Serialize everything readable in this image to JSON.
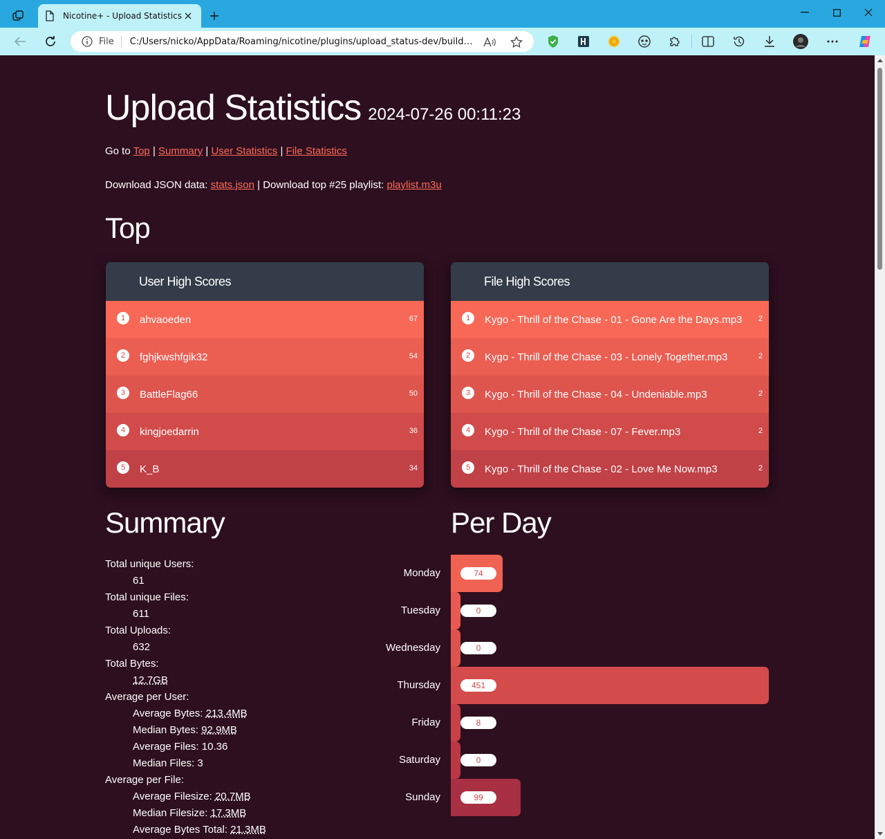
{
  "browser": {
    "tab_title": "Nicotine+ - Upload Statistics",
    "scheme": "File",
    "url": "C:/Users/nicko/AppData/Roaming/nicotine/plugins/upload_status-dev/build/in..."
  },
  "page": {
    "title": "Upload Statistics",
    "timestamp": "2024-07-26 00:11:23",
    "nav": {
      "prefix": "Go to",
      "links": [
        "Top",
        "Summary",
        "User Statistics",
        "File Statistics"
      ]
    },
    "downloads": {
      "json_prefix": "Download JSON data:",
      "json_link": "stats.json",
      "playlist_prefix": "| Download top #25 playlist:",
      "playlist_link": "playlist.m3u"
    },
    "top_heading": "Top",
    "user_scores": {
      "title": "User High Scores",
      "rows": [
        {
          "rank": "1",
          "name": "ahvaoeden",
          "score": "67"
        },
        {
          "rank": "2",
          "name": "fghjkwshfgik32",
          "score": "54"
        },
        {
          "rank": "3",
          "name": "BattleFlag66",
          "score": "50"
        },
        {
          "rank": "4",
          "name": "kingjoedarrin",
          "score": "36"
        },
        {
          "rank": "5",
          "name": "K_B",
          "score": "34"
        }
      ]
    },
    "file_scores": {
      "title": "File High Scores",
      "rows": [
        {
          "rank": "1",
          "name": "Kygo - Thrill of the Chase - 01 - Gone Are the Days.mp3",
          "score": "2"
        },
        {
          "rank": "2",
          "name": "Kygo - Thrill of the Chase - 03 - Lonely Together.mp3",
          "score": "2"
        },
        {
          "rank": "3",
          "name": "Kygo - Thrill of the Chase - 04 - Undeniable.mp3",
          "score": "2"
        },
        {
          "rank": "4",
          "name": "Kygo - Thrill of the Chase - 07 - Fever.mp3",
          "score": "2"
        },
        {
          "rank": "5",
          "name": "Kygo - Thrill of the Chase - 02 - Love Me Now.mp3",
          "score": "2"
        }
      ]
    },
    "summary": {
      "heading": "Summary",
      "unique_users_label": "Total unique Users:",
      "unique_users": "61",
      "unique_files_label": "Total unique Files:",
      "unique_files": "611",
      "uploads_label": "Total Uploads:",
      "uploads": "632",
      "bytes_label": "Total Bytes:",
      "bytes": "12.7GB",
      "per_user_label": "Average per User:",
      "avg_bytes_label": "Average Bytes:",
      "avg_bytes": "213.4MB",
      "median_bytes_label": "Median Bytes:",
      "median_bytes": "92.9MB",
      "avg_files_label": "Average Files:",
      "avg_files": "10.36",
      "median_files_label": "Median Files:",
      "median_files": "3",
      "per_file_label": "Average per File:",
      "avg_filesize_label": "Average Filesize:",
      "avg_filesize": "20.7MB",
      "median_filesize_label": "Median Filesize:",
      "median_filesize": "17.3MB",
      "avg_bytes_total_label": "Average Bytes Total:",
      "avg_bytes_total": "21.3MB"
    },
    "per_day": {
      "heading": "Per Day",
      "max": 451,
      "days": [
        {
          "day": "Monday",
          "value": 74,
          "label": "74",
          "color": "#f06353"
        },
        {
          "day": "Tuesday",
          "value": 0,
          "label": "0",
          "color": "#e85a51"
        },
        {
          "day": "Wednesday",
          "value": 0,
          "label": "0",
          "color": "#de534e"
        },
        {
          "day": "Thursday",
          "value": 451,
          "label": "451",
          "color": "#d44b4b"
        },
        {
          "day": "Friday",
          "value": 8,
          "label": "8",
          "color": "#c84148"
        },
        {
          "day": "Saturday",
          "value": 0,
          "label": "0",
          "color": "#bb3845"
        },
        {
          "day": "Sunday",
          "value": 99,
          "label": "99",
          "color": "#a92f42"
        }
      ]
    }
  },
  "colors": {
    "background": "#2d0f1f",
    "accent": "#ff6b58",
    "card_header": "#333c48",
    "tabbar": "#29a8e0",
    "toolbar": "#bff1f8"
  },
  "icons": {
    "tab_actions": "tab-actions-icon",
    "page": "page-icon",
    "close": "close-icon",
    "new_tab": "plus-icon",
    "back": "back-arrow-icon",
    "reload": "reload-icon",
    "info": "info-icon",
    "read_aloud": "read-aloud-icon",
    "favorite": "star-icon"
  }
}
